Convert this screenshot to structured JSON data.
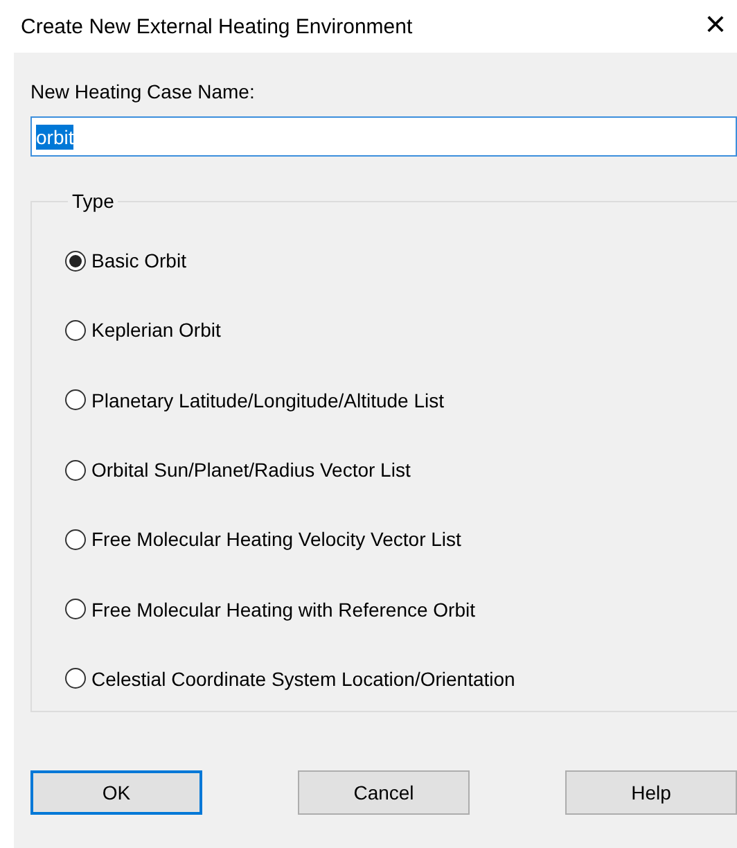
{
  "window": {
    "title": "Create New External Heating Environment",
    "close": "×"
  },
  "name_field": {
    "label": "New Heating Case Name:",
    "value": "orbit",
    "text_selected": true
  },
  "type_group": {
    "title": "Type",
    "options": [
      {
        "label": "Basic Orbit",
        "selected": true
      },
      {
        "label": "Keplerian Orbit",
        "selected": false
      },
      {
        "label": "Planetary Latitude/Longitude/Altitude List",
        "selected": false
      },
      {
        "label": "Orbital Sun/Planet/Radius Vector List",
        "selected": false
      },
      {
        "label": "Free Molecular Heating Velocity Vector List",
        "selected": false
      },
      {
        "label": "Free Molecular Heating with Reference Orbit",
        "selected": false
      },
      {
        "label": "Celestial Coordinate System Location/Orientation",
        "selected": false
      }
    ]
  },
  "buttons": [
    {
      "label": "OK",
      "focused": true
    },
    {
      "label": "Cancel",
      "focused": false
    },
    {
      "label": "Help",
      "focused": false
    }
  ]
}
